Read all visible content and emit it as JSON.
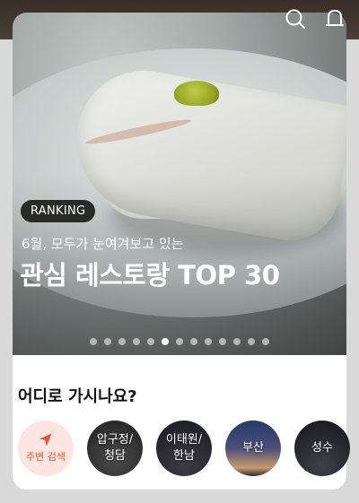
{
  "header": {
    "icons": [
      "search-icon",
      "bell-icon"
    ]
  },
  "hero": {
    "badge": "RANKING",
    "subtitle": "6월, 모두가 눈여겨보고 있는",
    "title": "관심 레스토랑 TOP 30",
    "carousel": {
      "total": 13,
      "active_index": 5
    }
  },
  "section": {
    "title": "어디로 가시나요?",
    "areas": [
      {
        "label_line1": "주변 검색",
        "label_line2": "",
        "icon": "navigation-arrow-icon"
      },
      {
        "label_line1": "압구정/",
        "label_line2": "청담"
      },
      {
        "label_line1": "이태원/",
        "label_line2": "한남"
      },
      {
        "label_line1": "부산",
        "label_line2": ""
      },
      {
        "label_line1": "성수",
        "label_line2": ""
      }
    ]
  },
  "colors": {
    "accent": "#e8542f",
    "badge_bg": "#2a2a26"
  }
}
